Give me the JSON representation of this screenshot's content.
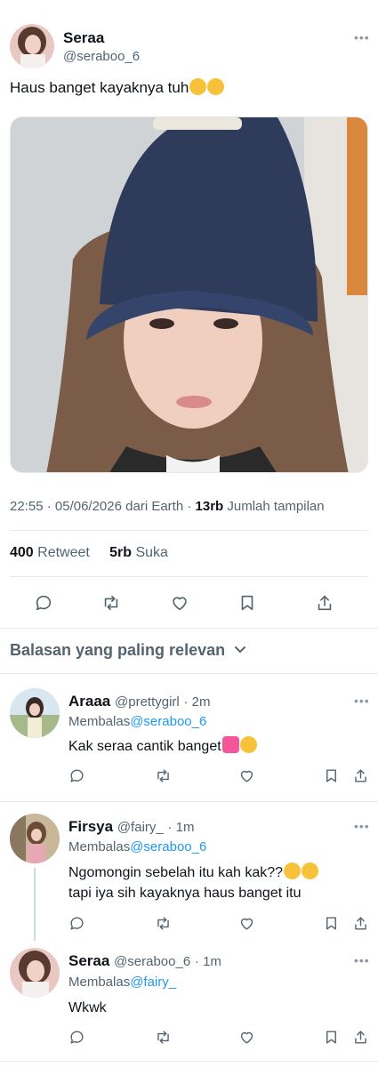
{
  "tweet": {
    "author": {
      "name": "Seraa",
      "handle": "@seraboo_6"
    },
    "text": "Haus banget kayaknya tuh",
    "emojis": [
      "sleeping-face",
      "sleeping-face"
    ],
    "time": "22:55",
    "date": "05/06/2026",
    "source": "dari Earth",
    "views_count": "13rb",
    "views_label": "Jumlah tampilan",
    "retweet_count": "400",
    "retweet_label": "Retweet",
    "like_count": "5rb",
    "like_label": "Suka"
  },
  "actions": [
    "reply-icon",
    "retweet-icon",
    "like-icon",
    "bookmark-icon",
    "share-icon"
  ],
  "sort": {
    "label": "Balasan yang paling relevan"
  },
  "replies": [
    {
      "name": "Araaa",
      "handle": "@prettygirl",
      "time": "· 2m",
      "replying_prefix": "Membalas",
      "replying_to": "@seraboo_6",
      "text": "Kak seraa cantik banget",
      "emojis": [
        "pink-heart",
        "loudly-crying-face"
      ]
    },
    {
      "name": "Firsya",
      "handle": "@fairy_",
      "time": "· 1m",
      "replying_prefix": "Membalas",
      "replying_to": "@seraboo_6",
      "text_line1": "Ngomongin sebelah itu kah kak??",
      "text_line2": "tapi iya sih kayaknya haus banget itu",
      "emojis": [
        "thinking-face",
        "thinking-face"
      ]
    },
    {
      "name": "Seraa",
      "handle": "@seraboo_6",
      "time": "· 1m",
      "replying_prefix": "Membalas",
      "replying_to": "@fairy_",
      "text": "Wkwk"
    }
  ],
  "colors": {
    "accent": "#1d9bf0",
    "text": "#0f1419",
    "muted": "#536471",
    "divider": "#e7eaed"
  }
}
